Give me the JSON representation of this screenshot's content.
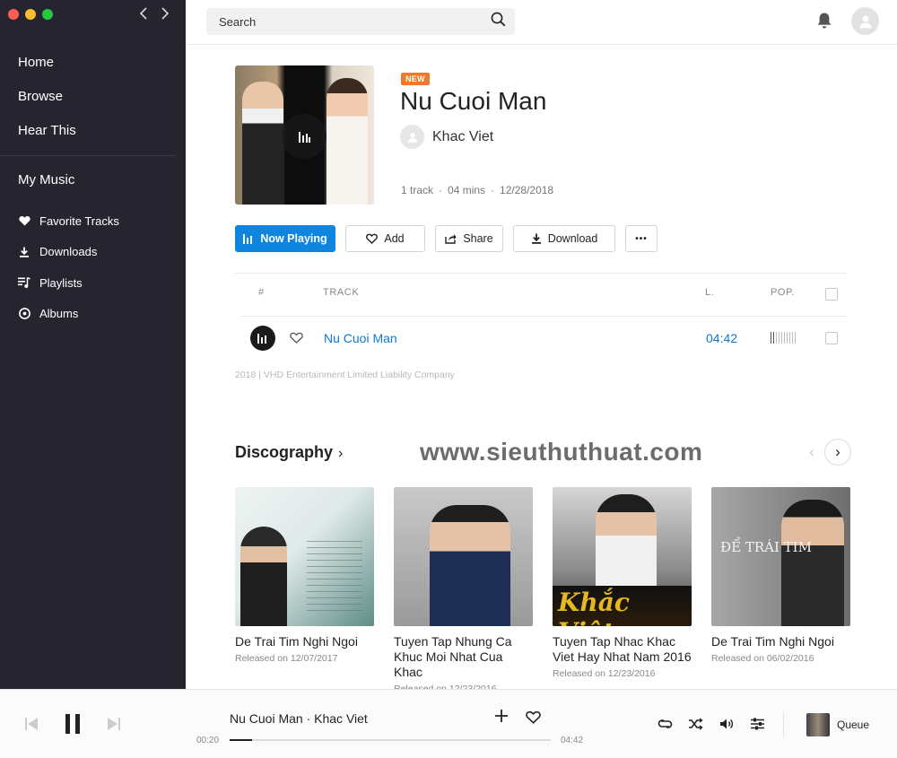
{
  "sidebar": {
    "nav": [
      {
        "label": "Home"
      },
      {
        "label": "Browse"
      },
      {
        "label": "Hear This"
      }
    ],
    "section_title": "My Music",
    "sub_nav": [
      {
        "label": "Favorite Tracks",
        "icon": "heart-icon"
      },
      {
        "label": "Downloads",
        "icon": "download-icon"
      },
      {
        "label": "Playlists",
        "icon": "playlist-icon"
      },
      {
        "label": "Albums",
        "icon": "album-icon"
      }
    ]
  },
  "header": {
    "search_placeholder": "Search"
  },
  "album": {
    "badge": "NEW",
    "title": "Nu Cuoi Man",
    "artist": "Khac Viet",
    "meta": {
      "tracks": "1 track",
      "duration": "04 mins",
      "date": "12/28/2018"
    },
    "actions": {
      "now_playing": "Now Playing",
      "add": "Add",
      "share": "Share",
      "download": "Download",
      "more": "•••"
    }
  },
  "tracks": {
    "headers": {
      "num": "#",
      "track": "TRACK",
      "length": "L.",
      "pop": "POP."
    },
    "rows": [
      {
        "name": "Nu Cuoi Man",
        "length": "04:42",
        "popularity": 0.15
      }
    ]
  },
  "copyright": "2018 | VHD Entertainment Limited Liability Company",
  "discography": {
    "title": "Discography",
    "chevron": "›",
    "watermark": "www.sieuthuthuat.com",
    "prev": "‹",
    "next": "›",
    "albums": [
      {
        "name": "De Trai Tim Nghi Ngoi",
        "released": "Released on 12/07/2017"
      },
      {
        "name": "Tuyen Tap Nhung Ca Khuc Moi Nhat Cua Khac",
        "released": "Released on 12/23/2016"
      },
      {
        "name": "Tuyen Tap Nhac Khac Viet Hay Nhat Nam 2016",
        "released": "Released on 12/23/2016"
      },
      {
        "name": "De Trai Tim Nghi Ngoi",
        "released": "Released on 06/02/2016"
      }
    ]
  },
  "player": {
    "now_playing": "Nu Cuoi Man · Khac Viet",
    "current_time": "00:20",
    "duration": "04:42",
    "progress": 0.07,
    "queue_label": "Queue"
  },
  "colors": {
    "sidebar_bg": "#26252f",
    "accent_blue": "#0e86e0",
    "link_blue": "#0e7ad1",
    "badge_orange": "#f5772a"
  }
}
